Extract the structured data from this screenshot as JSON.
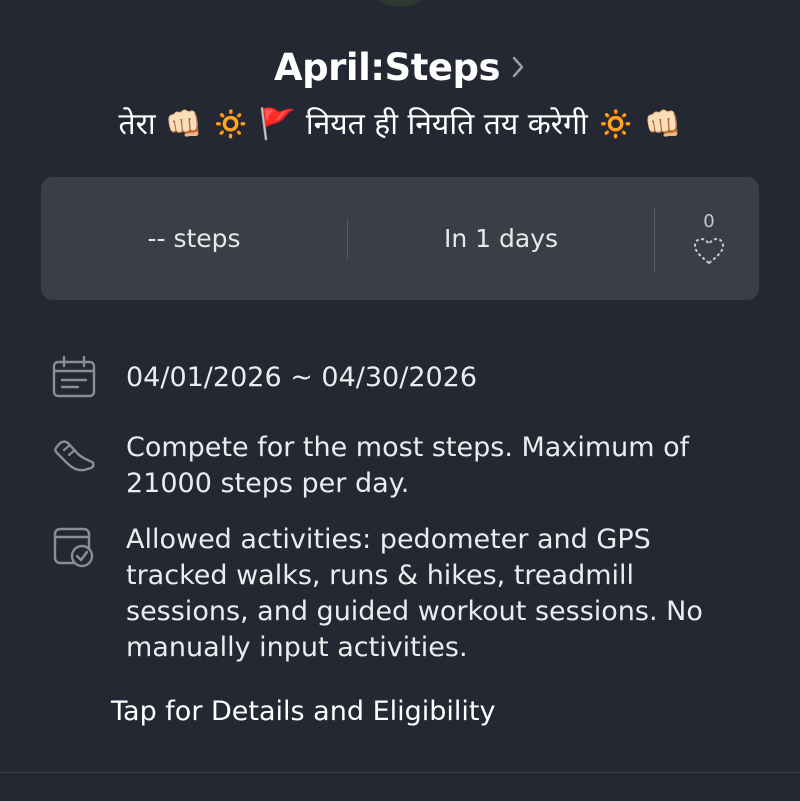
{
  "header": {
    "title": "April:Steps",
    "subtitle": "तेरा 👊🏻 🔅 🚩 नियत ही नियति तय करेगी 🔅 👊🏻"
  },
  "stats": {
    "steps": "-- steps",
    "days_left": "In 1 days",
    "like_count": "0"
  },
  "info": {
    "date_range": "04/01/2026 ~ 04/30/2026",
    "goal": "Compete for the most steps. Maximum of 21000 steps per day.",
    "activities": "Allowed activities: pedometer and GPS tracked walks, runs & hikes, treadmill sessions, and guided workout sessions. No manually input activities."
  },
  "link": {
    "details": "Tap for Details and Eligibility"
  },
  "icons": {
    "title_chevron": "chevron-right-icon",
    "like": "heart-outline-icon",
    "calendar": "calendar-icon",
    "shoe": "shoe-icon",
    "activity_check": "calendar-check-icon"
  },
  "colors": {
    "background": "#232833",
    "card": "#3a3f47",
    "icon_gray": "#8a8e96"
  }
}
